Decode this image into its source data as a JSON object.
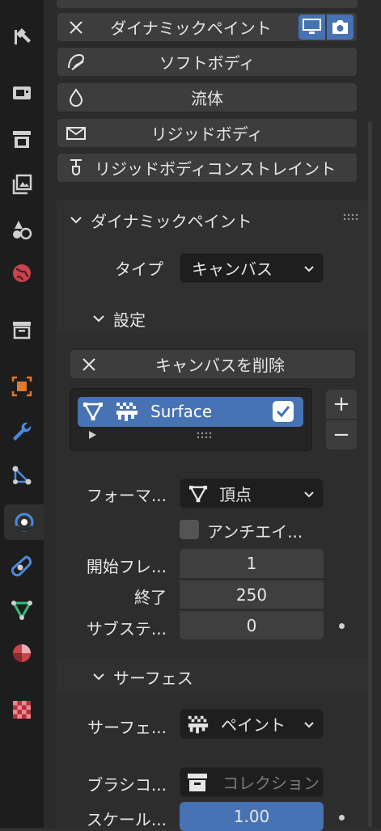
{
  "physics_buttons": [
    {
      "label": "ダイナミックペイント",
      "icon": "close-icon"
    },
    {
      "label": "ソフトボディ",
      "icon": "softbody-icon"
    },
    {
      "label": "流体",
      "icon": "fluid-drop-icon"
    },
    {
      "label": "リジッドボディ",
      "icon": "rigidbody-icon"
    },
    {
      "label": "リジッドボディコンストレイント",
      "icon": "constraint-icon"
    }
  ],
  "panel": {
    "title": "ダイナミックペイント",
    "type_label": "タイプ",
    "type_value": "キャンバス",
    "settings_label": "設定",
    "remove_canvas_label": "キャンバスを削除",
    "surface_item": "Surface",
    "format_label": "フォーマ...",
    "format_value": "頂点",
    "antialias_label": "アンチエイ...",
    "frame_start_label": "開始フレ...",
    "frame_start_value": "1",
    "frame_end_label": "終了",
    "frame_end_value": "250",
    "substeps_label": "サブステ...",
    "substeps_value": "0",
    "surface_section_label": "サーフェス",
    "surface_type_label": "サーフェ...",
    "surface_type_value": "ペイント",
    "brush_collection_label": "ブラシコ...",
    "brush_collection_placeholder": "コレクション",
    "scale_label": "スケール...",
    "scale_value": "1.00"
  },
  "list_controls": {
    "add": "+",
    "remove": "−"
  },
  "colors": {
    "accent": "#4772b3",
    "active_icon": "#4a8be0"
  }
}
